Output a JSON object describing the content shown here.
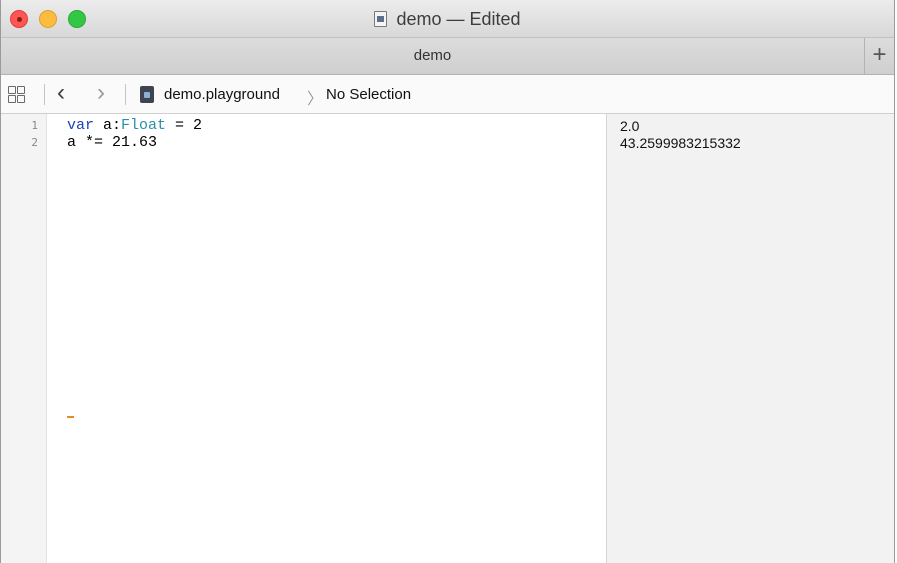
{
  "window": {
    "title": "demo — Edited"
  },
  "tabbar": {
    "tab_label": "demo",
    "add_label": "+"
  },
  "jumpbar": {
    "back_glyph": "‹",
    "forward_glyph": "›",
    "file_label": "demo.playground",
    "selection_label": "No Selection",
    "chevron_glyph": "〉"
  },
  "editor": {
    "lines": [
      {
        "number": "1",
        "keyword": "var",
        "ident": " a:",
        "type": "Float",
        "rest": " = 2"
      },
      {
        "number": "2",
        "text": "a *= 21.63"
      }
    ]
  },
  "results": {
    "values": [
      "2.0",
      "43.2599983215332"
    ]
  },
  "colors": {
    "keyword": "#1a44b8",
    "type": "#2a8fa8",
    "close": "#fc5753",
    "minimize": "#fdbc40",
    "maximize": "#33c748"
  },
  "icons": [
    "close-button",
    "minimize-button",
    "maximize-button",
    "document-icon",
    "grid-icon",
    "playground-file-icon"
  ]
}
